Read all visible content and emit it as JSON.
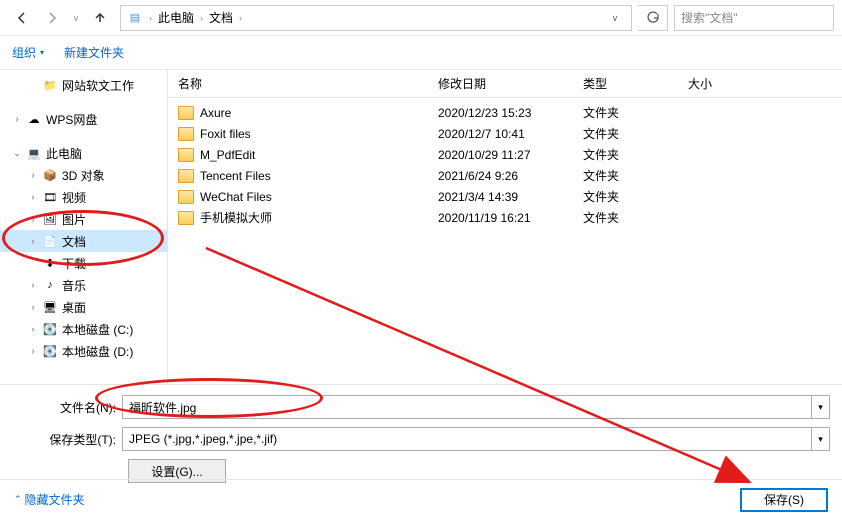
{
  "toolbar": {
    "breadcrumb": {
      "root": "此电脑",
      "current": "文档"
    },
    "search_placeholder": "搜索\"文档\""
  },
  "cmdbar": {
    "organize": "组织",
    "new_folder": "新建文件夹"
  },
  "sidebar": {
    "items": [
      {
        "label": "网站软文工作",
        "icon": "folder",
        "level": 2,
        "expand": ""
      },
      {
        "label": "WPS网盘",
        "icon": "wps",
        "level": 1,
        "expand": ">"
      },
      {
        "label": "此电脑",
        "icon": "pc",
        "level": 1,
        "expand": "v"
      },
      {
        "label": "3D 对象",
        "icon": "3d",
        "level": 2,
        "expand": ">"
      },
      {
        "label": "视频",
        "icon": "video",
        "level": 2,
        "expand": ">"
      },
      {
        "label": "图片",
        "icon": "image",
        "level": 2,
        "expand": ">"
      },
      {
        "label": "文档",
        "icon": "doc",
        "level": 2,
        "expand": ">",
        "selected": true
      },
      {
        "label": "下载",
        "icon": "download",
        "level": 2,
        "expand": ""
      },
      {
        "label": "音乐",
        "icon": "music",
        "level": 2,
        "expand": ">"
      },
      {
        "label": "桌面",
        "icon": "desktop",
        "level": 2,
        "expand": ">"
      },
      {
        "label": "本地磁盘 (C:)",
        "icon": "disk",
        "level": 2,
        "expand": ">"
      },
      {
        "label": "本地磁盘 (D:)",
        "icon": "disk",
        "level": 2,
        "expand": ">"
      }
    ]
  },
  "headers": {
    "name": "名称",
    "date": "修改日期",
    "type": "类型",
    "size": "大小"
  },
  "files": [
    {
      "name": "Axure",
      "date": "2020/12/23 15:23",
      "type": "文件夹"
    },
    {
      "name": "Foxit files",
      "date": "2020/12/7 10:41",
      "type": "文件夹"
    },
    {
      "name": "M_PdfEdit",
      "date": "2020/10/29 11:27",
      "type": "文件夹"
    },
    {
      "name": "Tencent Files",
      "date": "2021/6/24 9:26",
      "type": "文件夹"
    },
    {
      "name": "WeChat Files",
      "date": "2021/3/4 14:39",
      "type": "文件夹"
    },
    {
      "name": "手机模拟大师",
      "date": "2020/11/19 16:21",
      "type": "文件夹"
    }
  ],
  "form": {
    "filename_label": "文件名(N):",
    "filename_value": "福昕软件.jpg",
    "filetype_label": "保存类型(T):",
    "filetype_value": "JPEG (*.jpg,*.jpeg,*.jpe,*.jif)",
    "settings_label": "设置(G)..."
  },
  "footer": {
    "hide_label": "隐藏文件夹",
    "save_label": "保存(S)"
  },
  "icons": {
    "wps": "☁",
    "pc": "💻",
    "3d": "📦",
    "video": "🎞",
    "image": "🖼",
    "doc": "📄",
    "download": "⬇",
    "music": "♪",
    "desktop": "🖥",
    "disk": "💽",
    "folder": "📁"
  }
}
